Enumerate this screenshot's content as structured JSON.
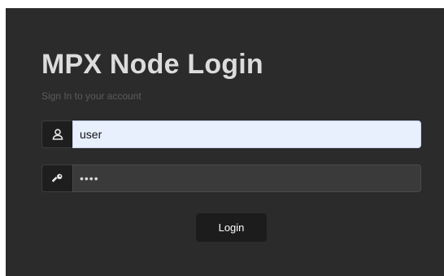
{
  "login": {
    "title": "MPX Node Login",
    "subtitle": "Sign In to your account",
    "username": {
      "value": "user",
      "icon": "user-icon"
    },
    "password": {
      "value": "••••",
      "icon": "key-icon"
    },
    "submit_label": "Login"
  }
}
